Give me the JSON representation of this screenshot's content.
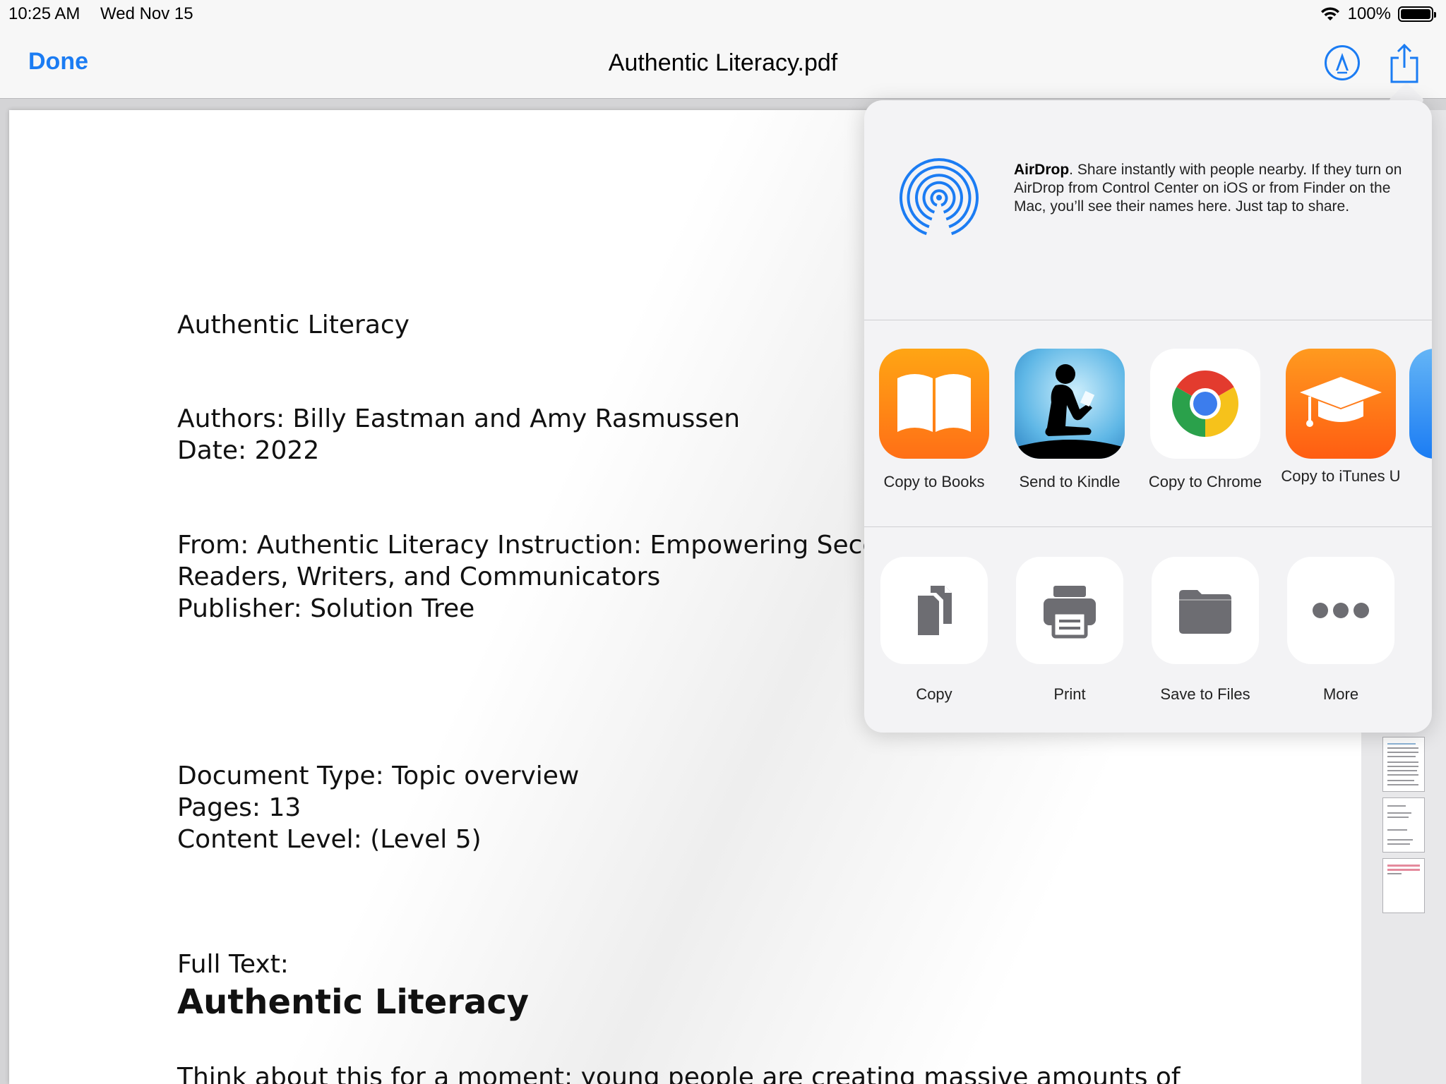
{
  "status": {
    "time": "10:25 AM",
    "date": "Wed Nov 15",
    "battery": "100%",
    "battery_level": 1.0
  },
  "nav": {
    "done_label": "Done",
    "title": "Authentic Literacy.pdf"
  },
  "document": {
    "lines": [
      "Authentic Literacy",
      "Authors:  Billy Eastman and Amy Rasmussen",
      "Date:  2022",
      "From: Authentic Literacy Instruction: Empowering Second",
      "Readers, Writers, and Communicators",
      "Publisher: Solution Tree",
      "Document Type:  Topic overview",
      "Pages: 13",
      "Content Level: (Level 5)",
      "Full Text:",
      "Authentic Literacy",
      "Think about this for a moment: young people are creating massive amounts of"
    ]
  },
  "share_sheet": {
    "airdrop_title": "AirDrop",
    "airdrop_desc": ". Share instantly with people nearby. If they turn on AirDrop from Control Center on iOS or from Finder on the Mac, you’ll see their names here. Just tap to share.",
    "apps": [
      {
        "label": "Copy to Books",
        "icon": "books-icon"
      },
      {
        "label": "Send to Kindle",
        "icon": "kindle-icon"
      },
      {
        "label": "Copy to Chrome",
        "icon": "chrome-icon"
      },
      {
        "label": "Copy to iTunes U",
        "icon": "itunes-u-icon"
      }
    ],
    "actions": [
      {
        "label": "Copy",
        "icon": "copy-icon"
      },
      {
        "label": "Print",
        "icon": "print-icon"
      },
      {
        "label": "Save to Files",
        "icon": "folder-icon"
      },
      {
        "label": "More",
        "icon": "more-icon"
      }
    ]
  },
  "colors": {
    "accent": "#1b7cf3",
    "action_glyph": "#6d6d72"
  }
}
